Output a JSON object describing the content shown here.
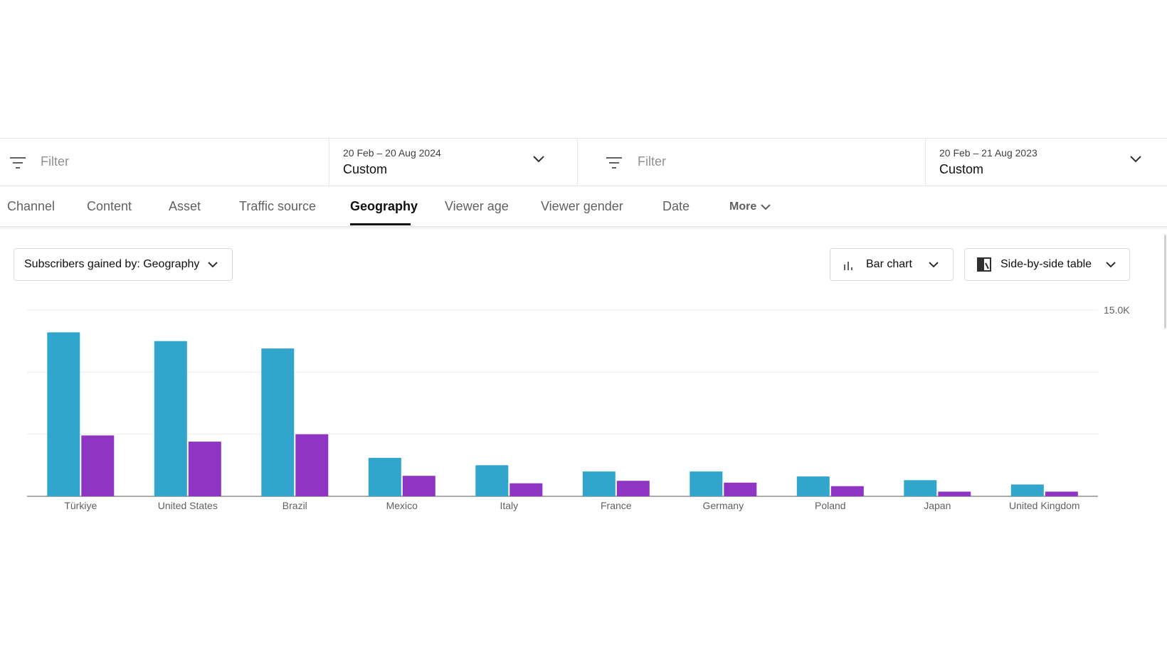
{
  "filters": {
    "left": {
      "placeholder": "Filter",
      "date_range": "20 Feb – 20 Aug 2024",
      "date_preset": "Custom"
    },
    "right": {
      "placeholder": "Filter",
      "date_range": "20 Feb – 21 Aug 2023",
      "date_preset": "Custom"
    }
  },
  "tabs": [
    {
      "label": "Channel"
    },
    {
      "label": "Content"
    },
    {
      "label": "Asset"
    },
    {
      "label": "Traffic source"
    },
    {
      "label": "Geography",
      "active": true
    },
    {
      "label": "Viewer age"
    },
    {
      "label": "Viewer gender"
    },
    {
      "label": "Date"
    },
    {
      "label": "More"
    }
  ],
  "toolbar": {
    "metric_selector": "Subscribers gained by: Geography",
    "chart_type": "Bar chart",
    "table_type": "Side-by-side table"
  },
  "colors": {
    "current_period": "#31a5cc",
    "previous_period": "#8e35c3",
    "grid": "#ececec",
    "axis": "#909090"
  },
  "chart_data": {
    "type": "bar",
    "categories": [
      "Türkiye",
      "United States",
      "Brazil",
      "Mexico",
      "Italy",
      "France",
      "Germany",
      "Poland",
      "Japan",
      "United Kingdom"
    ],
    "series": [
      {
        "values": [
          13200,
          12500,
          11900,
          3100,
          2500,
          2000,
          2000,
          1600,
          1300,
          950
        ]
      },
      {
        "values": [
          4900,
          4400,
          5000,
          1650,
          1050,
          1250,
          1100,
          820,
          380,
          380
        ]
      }
    ],
    "ylim": [
      0,
      15000
    ],
    "y_tick_labels": [
      "15.0K"
    ],
    "grid": true
  }
}
